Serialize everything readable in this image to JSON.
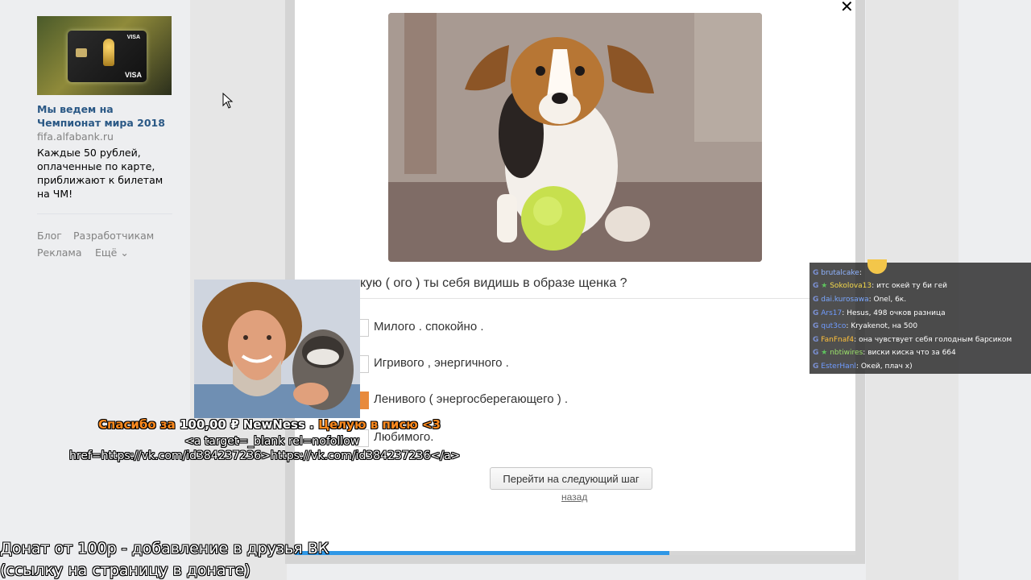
{
  "sidebar_ad": {
    "title": "Мы ведем на Чемпионат мира 2018",
    "domain": "fifa.alfabank.ru",
    "text": "Каждые 50 рублей, оплаченные по карте, приближают к билетам на ЧМ!",
    "card_visa_top": "VISA",
    "card_visa_bottom": "VISA"
  },
  "footer_links": [
    "Блог",
    "Разработчикам",
    "Реклама",
    "Ещё ⌄"
  ],
  "modal": {
    "close_glyph": "✕",
    "question": "кую ( ого ) ты себя видишь в образе щенка ?",
    "options": [
      {
        "label": "Милого . спокойно .",
        "checked": false
      },
      {
        "label": "Игривого , энергичного .",
        "checked": false
      },
      {
        "label": "Ленивого ( энергосберегающего ) .",
        "checked": true
      },
      {
        "label": "Любимого.",
        "checked": false
      }
    ],
    "next_button": "Перейти на следующий шаг",
    "back_link": "назад",
    "progress_fraction": 0.668
  },
  "chat": {
    "messages": [
      {
        "user": "brutalcake",
        "text": "",
        "user_color": "#8fb3ff",
        "star": false
      },
      {
        "user": "Sokolova13",
        "text": "итс окей ту би гей",
        "user_color": "#f5d94a",
        "star": true
      },
      {
        "user": "dai.kurosawa",
        "text": "Onel, 6к.",
        "user_color": "#7aa7ff",
        "star": false
      },
      {
        "user": "Ars17",
        "text": "Hesus, 498 очков разница",
        "user_color": "#6f9bff",
        "star": false
      },
      {
        "user": "qut3co",
        "text": "Kryakenot, на 500",
        "user_color": "#6f9bff",
        "star": false
      },
      {
        "user": "FanFnaf4",
        "text": "она чувствует себя голодным барсиком",
        "user_color": "#ffc03a",
        "star": false
      },
      {
        "user": "nbtiwires",
        "text": "виски киска что за 664",
        "user_color": "#9be36a",
        "star": true
      },
      {
        "user": "EsterHanl",
        "text": "Окей, плач х)",
        "user_color": "#6f9bff",
        "star": false
      }
    ]
  },
  "donation": {
    "prefix": "Спасибо за",
    "amount": "100,00 ₽ NewNess",
    "sep": ".",
    "suffix": "Целую в писю <3",
    "html_line1": "<a target=_blank rel=nofollow",
    "html_line2": "href=https://vk.com/id384237236>https://vk.com/id384237236</a>"
  },
  "overlay": {
    "line1": "Донат от 100р - добавление в друзья ВК",
    "line2": "(ссылку на страницу в донате)"
  },
  "colors": {
    "link_blue": "#2a5885",
    "checkbox_orange": "#e88a3c",
    "progress_blue": "#2f97e6"
  }
}
